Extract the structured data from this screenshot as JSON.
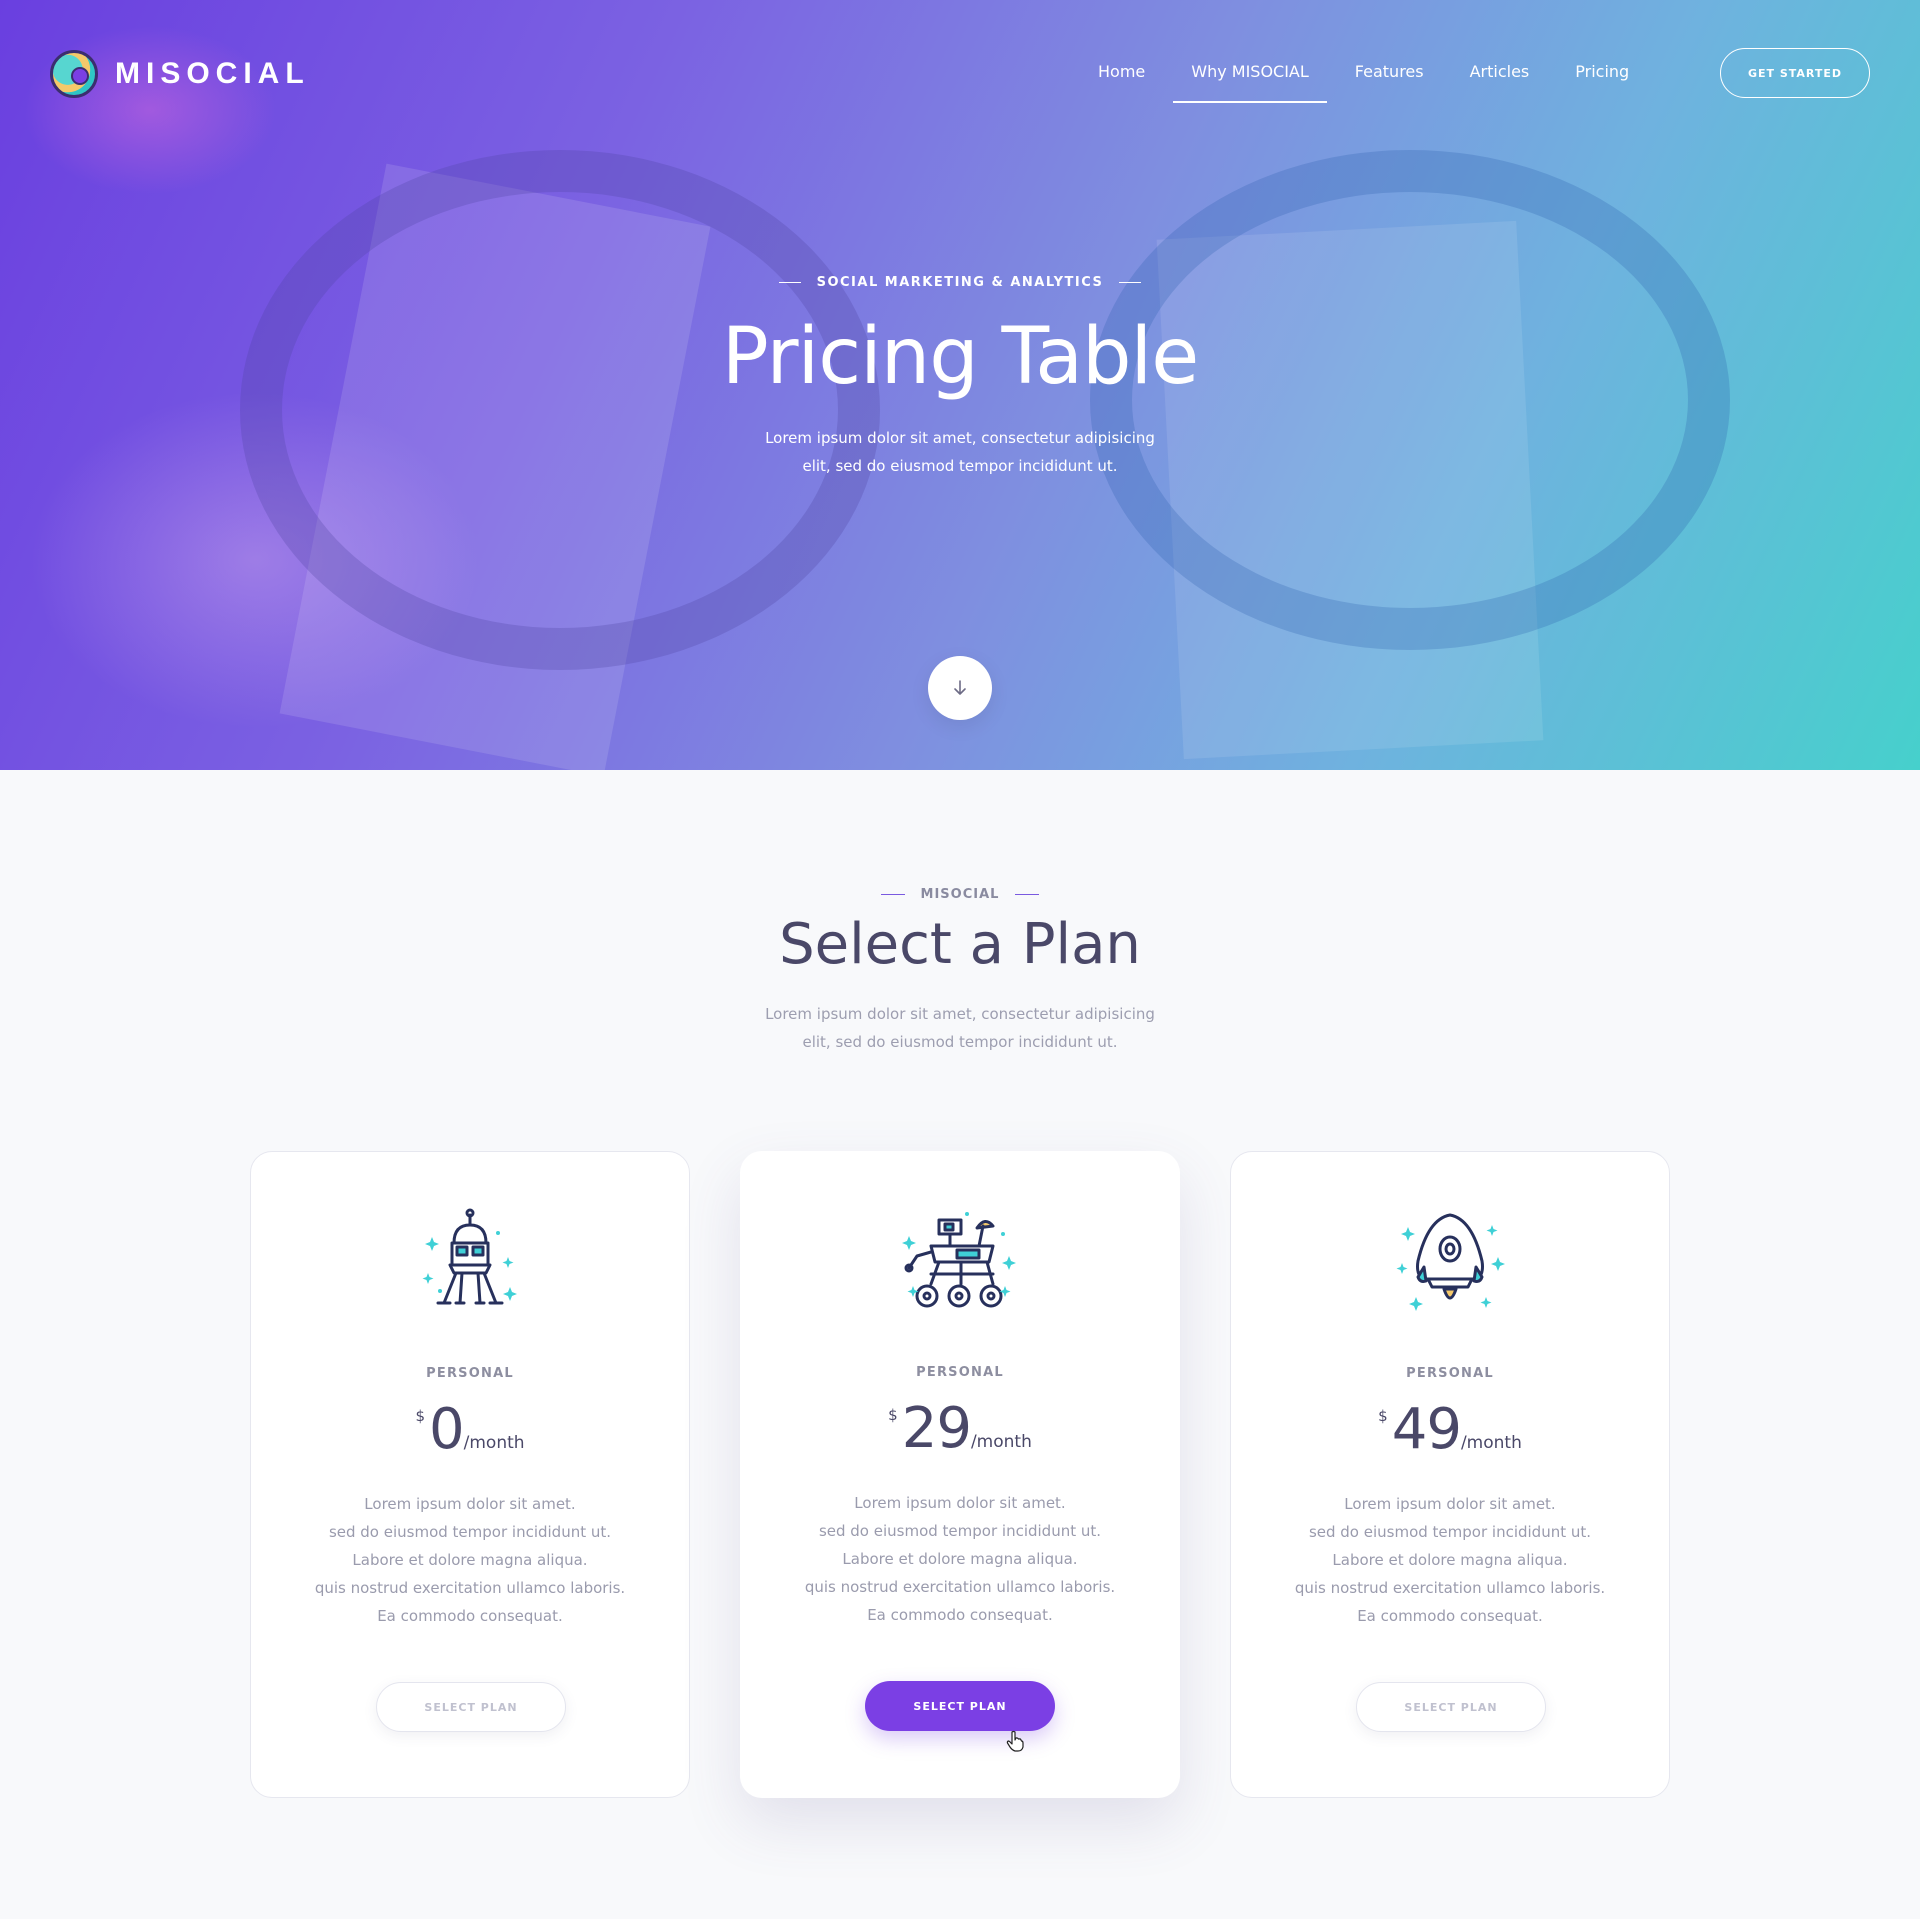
{
  "brand": {
    "name": "MISOCIAL"
  },
  "nav": {
    "items": [
      {
        "label": "Home"
      },
      {
        "label": "Why MISOCIAL"
      },
      {
        "label": "Features"
      },
      {
        "label": "Articles"
      },
      {
        "label": "Pricing"
      }
    ],
    "active_index": 1,
    "cta_label": "GET STARTED"
  },
  "hero": {
    "eyebrow": "SOCIAL MARKETING & ANALYTICS",
    "title": "Pricing Table",
    "subtitle": "Lorem ipsum dolor sit amet, consectetur adipisicing elit, sed do eiusmod tempor incididunt ut.",
    "scroll_icon": "arrow-down-icon"
  },
  "plans_section": {
    "eyebrow": "MISOCIAL",
    "title": "Select a Plan",
    "subtitle": "Lorem ipsum dolor sit amet, consectetur adipisicing elit, sed do eiusmod tempor incididunt ut."
  },
  "plans": [
    {
      "icon": "lunar-lander-icon",
      "tier": "PERSONAL",
      "currency": "$",
      "amount": "0",
      "period": "/month",
      "features": [
        "Lorem ipsum dolor sit amet.",
        "sed do eiusmod tempor incididunt ut.",
        "Labore et dolore magna aliqua.",
        "quis nostrud exercitation ullamco laboris.",
        "Ea commodo consequat."
      ],
      "button": "SELECT PLAN"
    },
    {
      "icon": "mars-rover-icon",
      "tier": "PERSONAL",
      "currency": "$",
      "amount": "29",
      "period": "/month",
      "features": [
        "Lorem ipsum dolor sit amet.",
        "sed do eiusmod tempor incididunt ut.",
        "Labore et dolore magna aliqua.",
        "quis nostrud exercitation ullamco laboris.",
        "Ea commodo consequat."
      ],
      "button": "SELECT PLAN"
    },
    {
      "icon": "space-capsule-icon",
      "tier": "PERSONAL",
      "currency": "$",
      "amount": "49",
      "period": "/month",
      "features": [
        "Lorem ipsum dolor sit amet.",
        "sed do eiusmod tempor incididunt ut.",
        "Labore et dolore magna aliqua.",
        "quis nostrud exercitation ullamco laboris.",
        "Ea commodo consequat."
      ],
      "button": "SELECT PLAN"
    }
  ],
  "colors": {
    "accent": "#7b3fe4",
    "teal": "#46d0cc",
    "heading": "#4a4868",
    "muted": "#9a9bad"
  }
}
